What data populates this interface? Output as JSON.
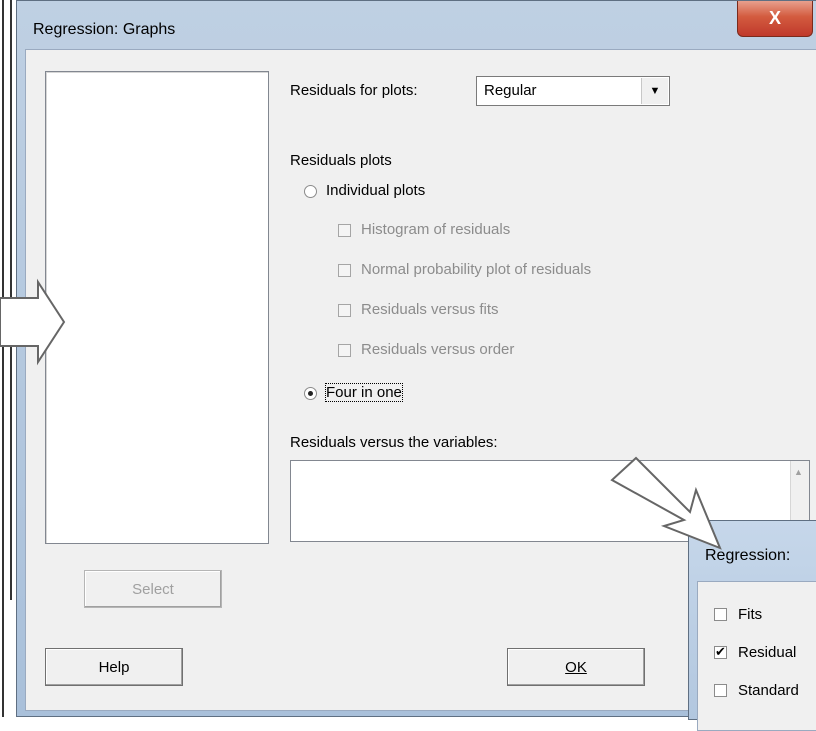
{
  "dialog": {
    "title": "Regression: Graphs",
    "close_label": "X"
  },
  "residuals_for_plots": {
    "label": "Residuals for plots:",
    "value": "Regular"
  },
  "residual_plots": {
    "heading": "Residuals plots",
    "individual_label": "Individual plots",
    "histogram_label": "Histogram of residuals",
    "normal_label": "Normal probability plot of residuals",
    "vs_fits_label": "Residuals versus fits",
    "vs_order_label": "Residuals versus order",
    "four_in_one_label": "Four in one",
    "selected": "Four in one"
  },
  "vs_variables": {
    "label": "Residuals versus the variables:"
  },
  "buttons": {
    "select": "Select",
    "help": "Help",
    "ok": "OK"
  },
  "second_dialog": {
    "title": "Regression:",
    "fits_label": "Fits",
    "residuals_label": "Residual",
    "standard_label": "Standard",
    "residuals_checked": true
  },
  "colors": {
    "close_button": "#c0392b",
    "frame": "#a9c0da"
  }
}
